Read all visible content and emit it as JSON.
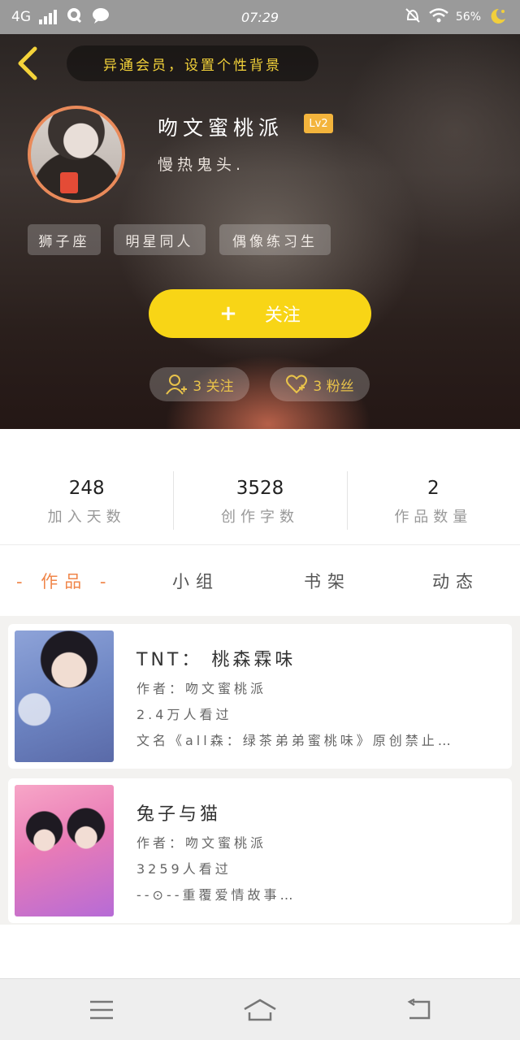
{
  "status_bar": {
    "network": "4G",
    "time": "07:29",
    "battery": "56%",
    "icons": [
      "signal-icon",
      "qq-icon",
      "chat-icon",
      "mute-icon",
      "wifi-icon",
      "battery-icon"
    ]
  },
  "header": {
    "bg_hint": "异通会员，设置个性背景",
    "username": "吻文蜜桃派",
    "level": "Lv2",
    "bio": "慢热鬼头.",
    "tags": [
      "狮子座",
      "明星同人",
      "偶像练习生"
    ],
    "follow_label": "关注",
    "follow_plus": "+",
    "following": "3 关注",
    "followers": "3 粉丝",
    "accent_color": "#f8d516"
  },
  "stats": [
    {
      "value": "248",
      "label": "加入天数"
    },
    {
      "value": "3528",
      "label": "创作字数"
    },
    {
      "value": "2",
      "label": "作品数量"
    }
  ],
  "tabs": [
    {
      "label": "- 作品 -",
      "active": true
    },
    {
      "label": "小组",
      "active": false
    },
    {
      "label": "书架",
      "active": false
    },
    {
      "label": "动态",
      "active": false
    }
  ],
  "works": [
    {
      "title": "TNT： 桃森霖味",
      "author": "作者：吻文蜜桃派",
      "views": "2.4万人看过",
      "desc": "文名《all森：绿茶弟弟蜜桃味》原创禁止…"
    },
    {
      "title": "兔子与猫",
      "author": "作者：吻文蜜桃派",
      "views": "3259人看过",
      "desc": "--⊙--重覆爱情故事…"
    }
  ],
  "bottom_nav": [
    "menu-icon",
    "home-icon",
    "back-icon"
  ]
}
